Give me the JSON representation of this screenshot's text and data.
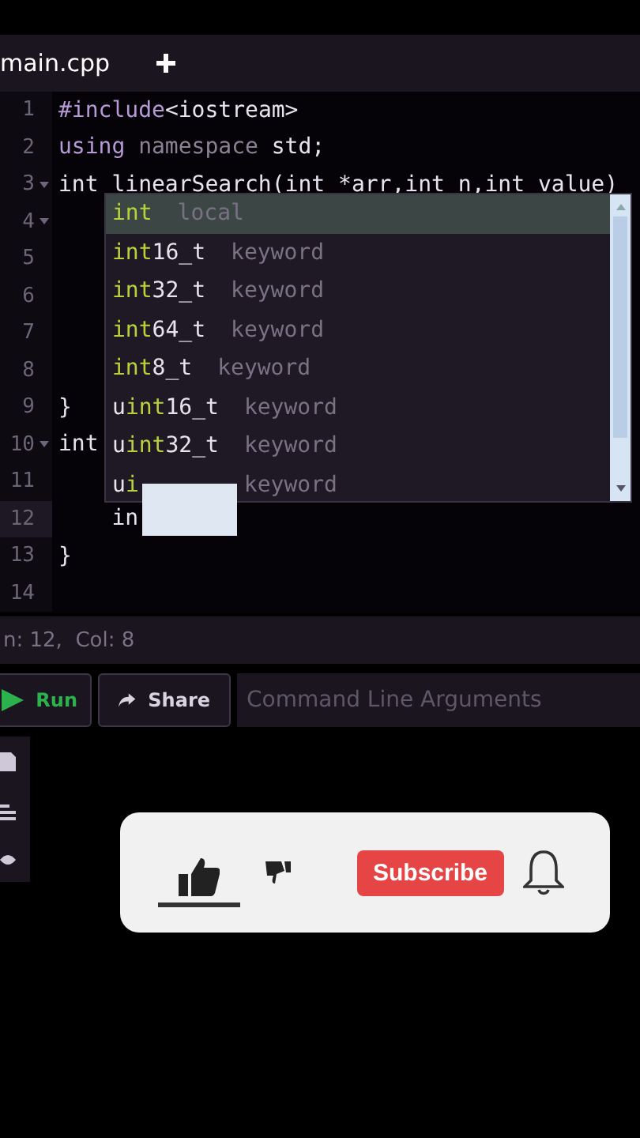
{
  "tabs": [
    {
      "label": "main.cpp",
      "selected": true
    }
  ],
  "code_lines": [
    {
      "number": "1",
      "fold": false,
      "current": false,
      "tokens": [
        {
          "text": "#include",
          "kind": "directive"
        },
        {
          "text": "<iostream>",
          "kind": "plain"
        }
      ]
    },
    {
      "number": "2",
      "fold": false,
      "current": false,
      "tokens": [
        {
          "text": "using ",
          "kind": "keyword"
        },
        {
          "text": "namespace ",
          "kind": "muted"
        },
        {
          "text": "std;",
          "kind": "plain"
        }
      ]
    },
    {
      "number": "3",
      "fold": true,
      "current": false,
      "tokens": [
        {
          "text": "int ",
          "kind": "plain"
        },
        {
          "text": "linearSearch(",
          "kind": "plain"
        },
        {
          "text": "int ",
          "kind": "plain"
        },
        {
          "text": "*arr,",
          "kind": "plain"
        },
        {
          "text": "int ",
          "kind": "plain"
        },
        {
          "text": "n,",
          "kind": "plain"
        },
        {
          "text": "int ",
          "kind": "plain"
        },
        {
          "text": "value)",
          "kind": "plain"
        }
      ]
    },
    {
      "number": "4",
      "fold": true,
      "current": false
    },
    {
      "number": "5",
      "fold": false,
      "current": false
    },
    {
      "number": "6",
      "fold": false,
      "current": false
    },
    {
      "number": "7",
      "fold": false,
      "current": false
    },
    {
      "number": "8",
      "fold": false,
      "current": false
    },
    {
      "number": "9",
      "fold": false,
      "current": false,
      "tokens": [
        {
          "text": "}",
          "kind": "plain"
        }
      ]
    },
    {
      "number": "10",
      "fold": true,
      "current": false,
      "tokens": [
        {
          "text": "int",
          "kind": "plain"
        }
      ]
    },
    {
      "number": "11",
      "fold": false,
      "current": false
    },
    {
      "number": "12",
      "fold": false,
      "current": true,
      "tokens": [
        {
          "text": "    in",
          "kind": "plain"
        }
      ]
    },
    {
      "number": "13",
      "fold": false,
      "current": false,
      "tokens": [
        {
          "text": "}",
          "kind": "plain"
        }
      ]
    },
    {
      "number": "14",
      "fold": false,
      "current": false
    }
  ],
  "autocomplete": {
    "items": [
      {
        "match": "int",
        "type": "local",
        "selected": true
      },
      {
        "match": "int",
        "rest": "16_t",
        "type": "keyword",
        "selected": false
      },
      {
        "match": "int",
        "rest": "32_t",
        "type": "keyword",
        "selected": false
      },
      {
        "match": "int",
        "rest": "64_t",
        "type": "keyword",
        "selected": false
      },
      {
        "match": "int",
        "rest": "8_t",
        "type": "keyword",
        "selected": false
      },
      {
        "prefix": "u",
        "match": "int",
        "rest": "16_t",
        "type": "keyword",
        "selected": false
      },
      {
        "prefix": "u",
        "match": "int",
        "rest": "32_t",
        "type": "keyword",
        "selected": false
      },
      {
        "prefix": "u",
        "match": "i",
        "type": "keyword",
        "selected": false
      }
    ]
  },
  "status": "n: 12,  Col: 8",
  "toolbar": {
    "run": "Run",
    "share": "Share",
    "args_placeholder": "Command Line Arguments"
  },
  "overlay": {
    "subscribe": "Subscribe",
    "liked": true
  }
}
